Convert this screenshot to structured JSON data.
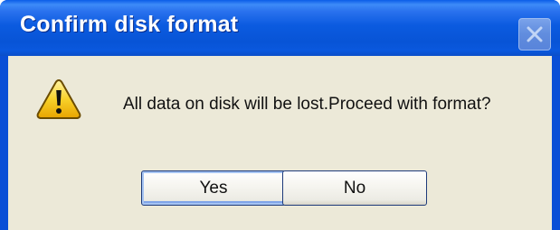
{
  "dialog": {
    "title": "Confirm disk format",
    "message": "All data on disk will be lost.Proceed with format?",
    "icon": "warning-icon",
    "buttons": {
      "yes_label": "Yes",
      "no_label": "No",
      "default": "Yes"
    },
    "colors": {
      "titlebar": "#0b5be0",
      "client_background": "#ece9d8",
      "warning_yellow": "#f5c518"
    }
  }
}
